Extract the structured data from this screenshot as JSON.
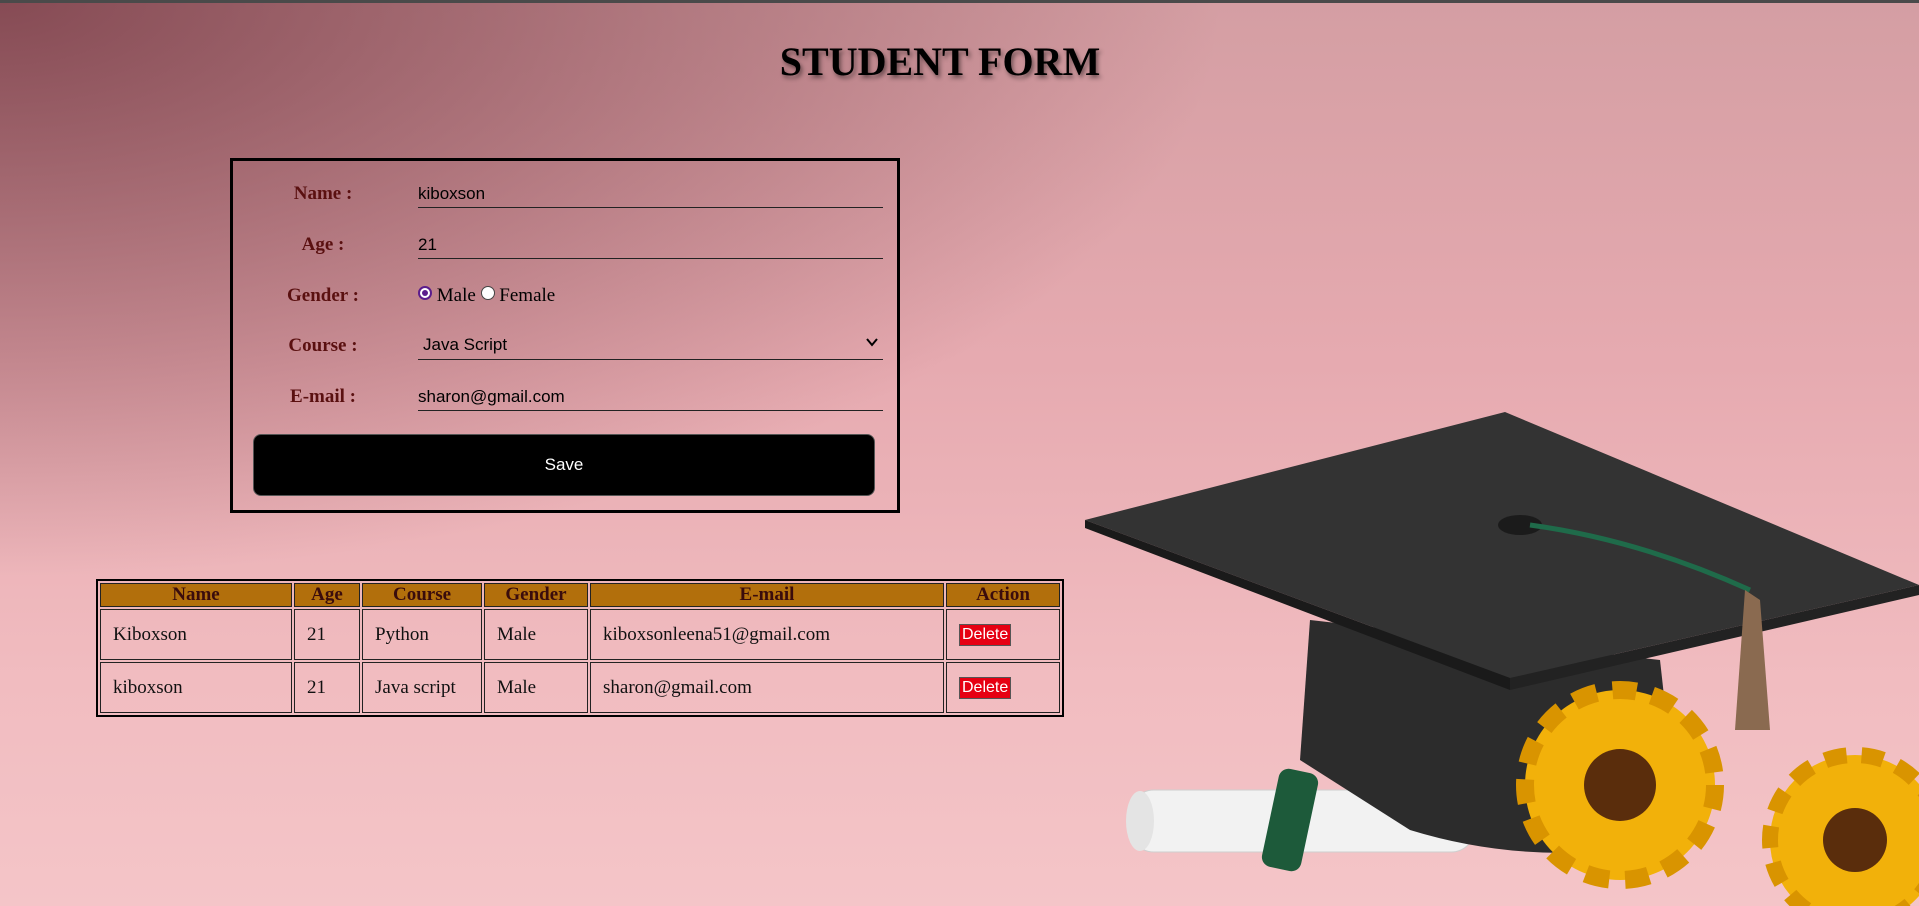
{
  "page": {
    "title": "STUDENT FORM"
  },
  "form": {
    "name_label": "Name :",
    "name_value": "kiboxson",
    "age_label": "Age :",
    "age_value": "21",
    "gender_label": "Gender :",
    "gender_options": [
      "Male",
      "Female"
    ],
    "gender_selected": "Male",
    "course_label": "Course :",
    "course_value": "Java Script",
    "email_label": "E-mail :",
    "email_value": "sharon@gmail.com",
    "save_label": "Save"
  },
  "table": {
    "headers": [
      "Name",
      "Age",
      "Course",
      "Gender",
      "E-mail",
      "Action"
    ],
    "rows": [
      {
        "name": "Kiboxson",
        "age": "21",
        "course": "Python",
        "gender": "Male",
        "email": "kiboxsonleena51@gmail.com",
        "action": "Delete"
      },
      {
        "name": "kiboxson",
        "age": "21",
        "course": "Java script",
        "gender": "Male",
        "email": "sharon@gmail.com",
        "action": "Delete"
      }
    ]
  },
  "colors": {
    "accent_header": "#b26f0c",
    "delete_button": "#e60012",
    "label_text": "#5a1010",
    "radio_accent": "#5b1d8c"
  },
  "icons": {
    "course_dropdown": "chevron-down-icon",
    "illustration": "graduation-cap-sunflowers-image"
  }
}
